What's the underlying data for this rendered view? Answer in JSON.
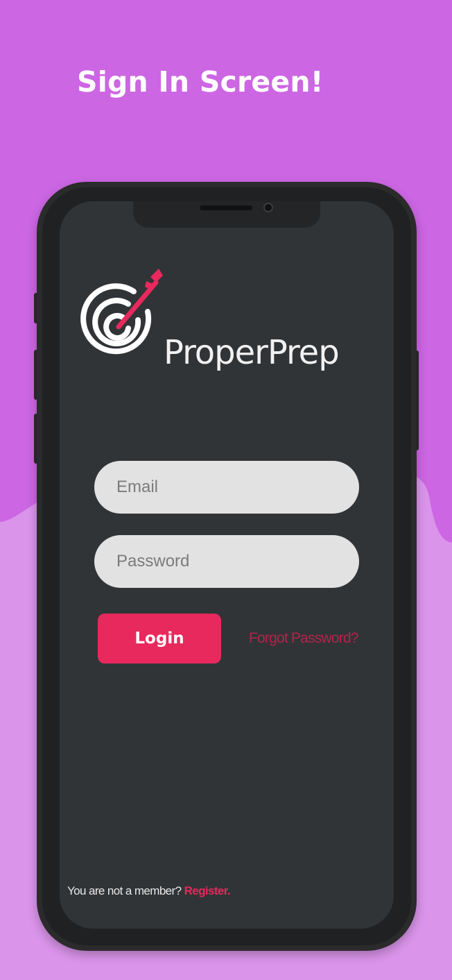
{
  "headline": "Sign In Screen!",
  "app": {
    "brand_name": "ProperPrep"
  },
  "form": {
    "email_placeholder": "Email",
    "password_placeholder": "Password",
    "login_label": "Login",
    "forgot_password_label": "Forgot Password?"
  },
  "footer": {
    "prompt": "You are not a member?",
    "register_label": "Register."
  },
  "colors": {
    "background_top": "#cc66e3",
    "background_bottom": "#da94ea",
    "screen": "#313437",
    "accent": "#e8295d",
    "input_fill": "#e2e2e2"
  },
  "icons": [
    "target-logo-icon"
  ]
}
